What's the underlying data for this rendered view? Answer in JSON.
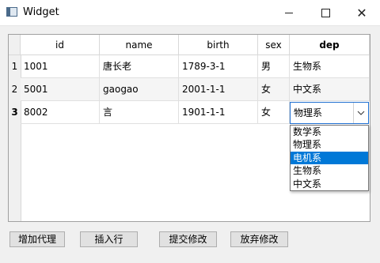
{
  "window": {
    "title": "Widget"
  },
  "table": {
    "columns": [
      "id",
      "name",
      "birth",
      "sex",
      "dep"
    ],
    "row_headers": [
      "1",
      "2",
      "3"
    ],
    "rows": [
      [
        "1001",
        "唐长老",
        "1789-3-1",
        "男",
        "生物系"
      ],
      [
        "5001",
        "gaogao",
        "2001-1-1",
        "女",
        "中文系"
      ],
      [
        "8002",
        "言",
        "1901-1-1",
        "女",
        "物理系"
      ]
    ]
  },
  "combo": {
    "value": "物理系",
    "options": [
      "数学系",
      "物理系",
      "电机系",
      "生物系",
      "中文系"
    ],
    "highlighted": "电机系"
  },
  "buttons": {
    "add_delegate": "增加代理",
    "insert_row": "插入行",
    "submit": "提交修改",
    "revert": "放弃修改"
  },
  "colors": {
    "selection": "#0078d7",
    "focus_border": "#1e6fd0"
  }
}
